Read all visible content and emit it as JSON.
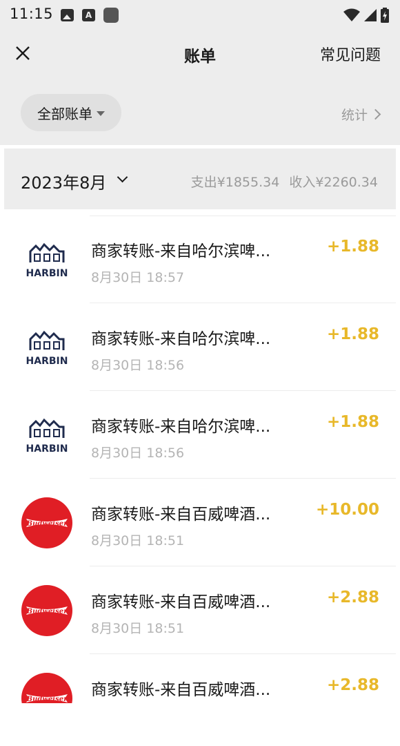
{
  "status_bar": {
    "time": "11:15",
    "left_icons": [
      "image-icon",
      "letter-a-icon",
      "app-icon"
    ],
    "right_icons": [
      "wifi-icon",
      "signal-icon",
      "battery-icon"
    ],
    "letter_icon_text": "A"
  },
  "nav": {
    "close_icon": "close-icon",
    "title": "账单",
    "faq_label": "常见问题"
  },
  "filter": {
    "label": "全部账单",
    "stats_label": "统计"
  },
  "month": {
    "label": "2023年8月",
    "expense": "支出¥1855.34",
    "income": "收入¥2260.34"
  },
  "colors": {
    "amount": "#e8b82a",
    "header_bg": "#ededed",
    "budweiser_red": "#e01e25",
    "harbin_navy": "#1f2b4d"
  },
  "transactions": [
    {
      "title": "商家转账-来自哈尔滨啤...",
      "time": "8月30日 18:57",
      "amount": "+1.88",
      "logo": "harbin-logo",
      "logo_text": "HARBIN"
    },
    {
      "title": "商家转账-来自哈尔滨啤...",
      "time": "8月30日 18:56",
      "amount": "+1.88",
      "logo": "harbin-logo",
      "logo_text": "HARBIN"
    },
    {
      "title": "商家转账-来自哈尔滨啤...",
      "time": "8月30日 18:56",
      "amount": "+1.88",
      "logo": "harbin-logo",
      "logo_text": "HARBIN"
    },
    {
      "title": "商家转账-来自百威啤酒...",
      "time": "8月30日 18:51",
      "amount": "+10.00",
      "logo": "budweiser-logo",
      "logo_text": "Budweiser"
    },
    {
      "title": "商家转账-来自百威啤酒...",
      "time": "8月30日 18:51",
      "amount": "+2.88",
      "logo": "budweiser-logo",
      "logo_text": "Budweiser"
    },
    {
      "title": "商家转账-来自百威啤酒...",
      "time": "",
      "amount": "+2.88",
      "logo": "budweiser-logo",
      "logo_text": "Budweiser"
    }
  ]
}
